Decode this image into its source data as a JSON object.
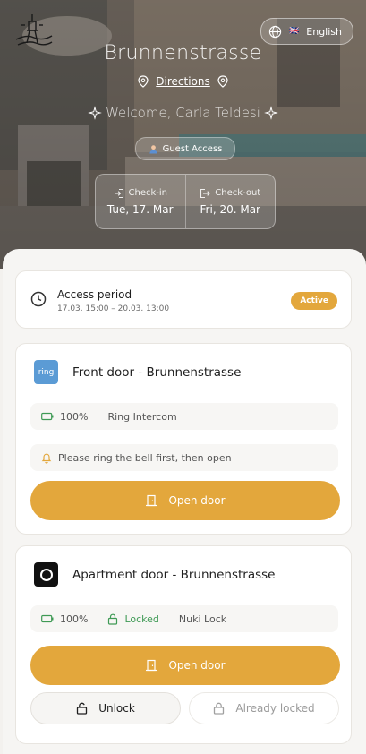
{
  "header": {
    "title": "Brunnenstrasse",
    "directions_label": "Directions",
    "welcome_text": "Welcome, Carla Teldesi",
    "guest_label": "Guest Access",
    "language": {
      "flag": "🇬🇧",
      "label": "English"
    }
  },
  "stay": {
    "checkin_label": "Check-in",
    "checkin_date": "Tue, 17. Mar",
    "checkout_label": "Check-out",
    "checkout_date": "Fri, 20. Mar"
  },
  "access": {
    "title": "Access period",
    "period": "17.03. 15:00 – 20.03. 13:00",
    "status": "Active"
  },
  "doors": [
    {
      "name": "Front door - Brunnenstrasse",
      "logo_text": "ring",
      "battery": "100%",
      "device": "Ring Intercom",
      "note": "Please ring the bell first, then open",
      "open_label": "Open door"
    },
    {
      "name": "Apartment door - Brunnenstrasse",
      "battery": "100%",
      "lock_state": "Locked",
      "device": "Nuki Lock",
      "open_label": "Open door",
      "unlock_label": "Unlock",
      "already_locked_label": "Already locked"
    }
  ],
  "colors": {
    "accent": "#e3a73c",
    "locked": "#3f9a55",
    "ring_blue": "#5b9bd5"
  }
}
